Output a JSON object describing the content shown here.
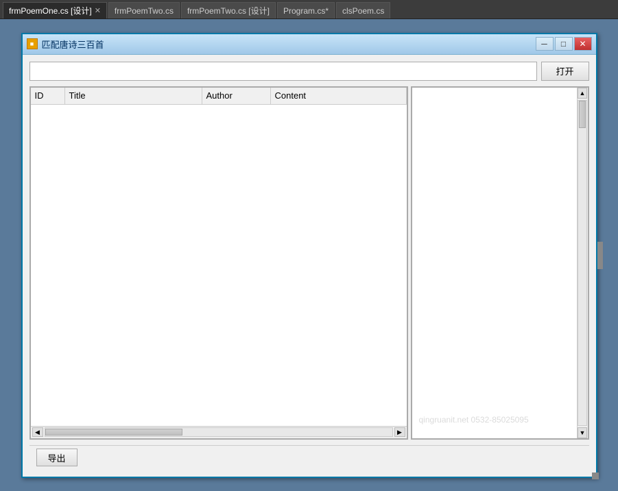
{
  "ide": {
    "tabs": [
      {
        "label": "frmPoemOne.cs [设计]",
        "active": true,
        "closable": true
      },
      {
        "label": "frmPoemTwo.cs",
        "active": false,
        "closable": false
      },
      {
        "label": "frmPoemTwo.cs [设计]",
        "active": false,
        "closable": false
      },
      {
        "label": "Program.cs*",
        "active": false,
        "closable": false
      },
      {
        "label": "clsPoem.cs",
        "active": false,
        "closable": false
      }
    ]
  },
  "form": {
    "title": "匹配唐诗三百首",
    "icon_text": "■",
    "min_btn": "─",
    "max_btn": "□",
    "close_btn": "✕",
    "search_placeholder": "",
    "open_btn_label": "打开",
    "export_btn_label": "导出",
    "grid": {
      "columns": [
        {
          "key": "id",
          "label": "ID"
        },
        {
          "key": "title",
          "label": "Title"
        },
        {
          "key": "author",
          "label": "Author"
        },
        {
          "key": "content",
          "label": "Content"
        }
      ]
    },
    "watermark": "qingruanit.net 0532-85025095"
  }
}
